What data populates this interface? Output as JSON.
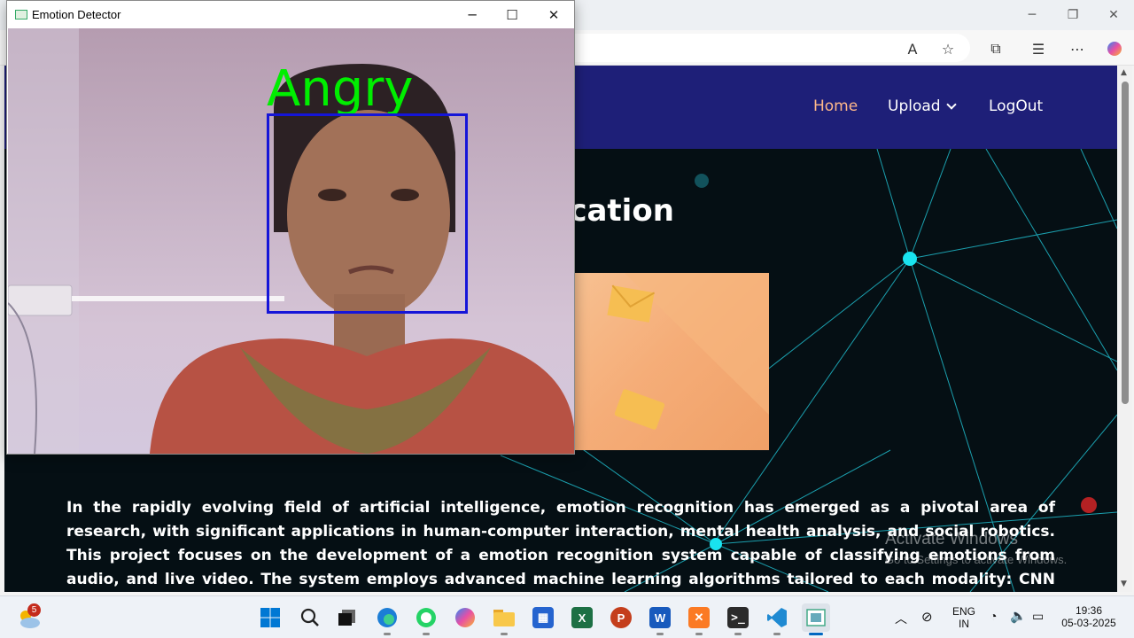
{
  "browser": {
    "window_controls": [
      "─",
      "❐",
      "✕"
    ]
  },
  "webpage": {
    "nav": {
      "home": "Home",
      "upload": "Upload",
      "logout": "LogOut"
    },
    "hero_title": "ssification",
    "description": "In the rapidly evolving field of artificial intelligence, emotion recognition has emerged as a pivotal area of research, with significant applications in human-computer interaction, mental health analysis, and social robotics. This project focuses on the development of a emotion recognition system capable of classifying emotions from audio, and live video. The system employs advanced machine learning algorithms tailored to each modality: CNN and LSTM for audio, and CNN for live video",
    "activate_windows": {
      "title": "Activate Windows",
      "subtitle": "Go to Settings to activate Windows."
    }
  },
  "detector_window": {
    "title": "Emotion Detector",
    "detected_emotion": "Angry",
    "label_color": "#00ee00",
    "box_color": "#1515d8"
  },
  "taskbar": {
    "weather_badge": "5",
    "language": "ENG",
    "region": "IN",
    "time": "19:36",
    "date": "05-03-2025",
    "apps": [
      "start-icon",
      "search-icon",
      "task-view-icon",
      "edge-icon",
      "whatsapp-icon",
      "copilot-icon",
      "file-explorer-icon",
      "store-icon",
      "excel-icon",
      "powerpoint-icon",
      "word-icon",
      "xampp-icon",
      "terminal-icon",
      "vscode-icon",
      "python-app-icon"
    ]
  }
}
